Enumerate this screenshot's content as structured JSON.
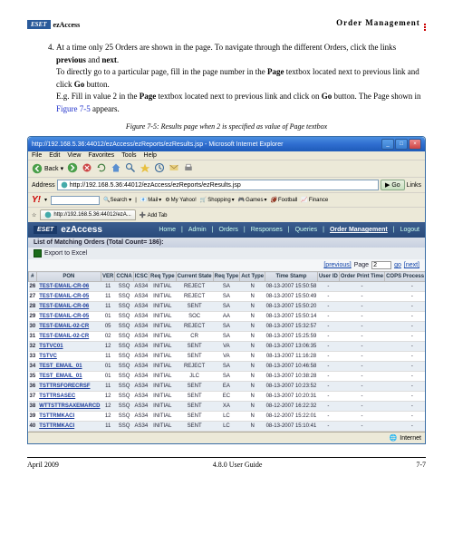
{
  "header": {
    "brand_badge": "ESET",
    "brand_text": "ezAccess",
    "title": "Order Management"
  },
  "instructions": {
    "item4_line1": "At a time only 25 Orders are shown in the page. To navigate through the different Orders, click the links ",
    "bold_prev": "previous",
    "and": " and ",
    "bold_next": "next",
    "period": ".",
    "line2a": "To directly go to a particular page, fill in the page number in the ",
    "bold_page": "Page",
    "line2b": " textbox located next to previous link and click ",
    "bold_go": "Go",
    "line2c": " button.",
    "line3a": "E.g. Fill in value 2 in the ",
    "line3b": " textbox located next to previous link and click on ",
    "line3c": " button. The Page shown in ",
    "figref": "Figure 7-5",
    "line3d": " appears."
  },
  "caption": "Figure 7-5:  Results page when 2 is specified as value of Page textbox",
  "browser": {
    "title_url": "http://192.168.5.36:44012/ezAccess/ezReports/ezResults.jsp - Microsoft Internet Explorer",
    "menus": [
      "File",
      "Edit",
      "View",
      "Favorites",
      "Tools",
      "Help"
    ],
    "back": "Back",
    "address_label": "Address",
    "address_value": "http://192.168.5.36:44012/ezAccess/ezReports/ezResults.jsp",
    "go_label": "Go",
    "links_label": "Links",
    "yahoo": {
      "search_btn": "Search",
      "links": [
        "Mail",
        "My Yahoo!",
        "Shopping",
        "Games",
        "Football",
        "Finance"
      ]
    },
    "tab_label": "http://192.168.5.36:44012/ezA...",
    "add_tab": "Add Tab",
    "status_text": "Internet"
  },
  "app": {
    "brand_badge": "ESET",
    "brand_text": "ezAccess",
    "nav": [
      "Home",
      "Admin",
      "Orders",
      "Responses",
      "Queries",
      "Order Management",
      "Logout"
    ],
    "list_title": "List of Matching Orders (Total Count= 186):",
    "export_label": "Export to Excel",
    "pager": {
      "previous": "[previous]",
      "page_label": "Page",
      "page_value": "2",
      "go": "go",
      "next": "[next]"
    },
    "columns": [
      "#",
      "PON",
      "VER",
      "CCNA",
      "ICSC",
      "Req Type",
      "Current State",
      "Req Type",
      "Act Type",
      "Time Stamp",
      "User ID",
      "Order Print Time",
      "COPS Process Time"
    ],
    "rows": [
      {
        "n": "26",
        "pon": "TEST-EMAIL-CR-06",
        "ver": "11",
        "ccna": "SSQ",
        "icsc": "AS34",
        "rt": "INITIAL",
        "cs": "REJECT",
        "rt2": "SA",
        "at": "N",
        "ts": "08-13-2007 15:50:58",
        "uid": "-",
        "opt": "-",
        "cpt": "-"
      },
      {
        "n": "27",
        "pon": "TEST-EMAIL-CR-05",
        "ver": "11",
        "ccna": "SSQ",
        "icsc": "AS34",
        "rt": "INITIAL",
        "cs": "REJECT",
        "rt2": "SA",
        "at": "N",
        "ts": "08-13-2007 15:50:49",
        "uid": "-",
        "opt": "-",
        "cpt": "-"
      },
      {
        "n": "28",
        "pon": "TEST-EMAIL-CR-06",
        "ver": "11",
        "ccna": "SSQ",
        "icsc": "AS34",
        "rt": "INITIAL",
        "cs": "SENT",
        "rt2": "SA",
        "at": "N",
        "ts": "08-13-2007 15:50:20",
        "uid": "-",
        "opt": "-",
        "cpt": "-"
      },
      {
        "n": "29",
        "pon": "TEST-EMAIL-CR-05",
        "ver": "01",
        "ccna": "SSQ",
        "icsc": "AS34",
        "rt": "INITIAL",
        "cs": "SOC",
        "rt2": "AA",
        "at": "N",
        "ts": "08-13-2007 15:50:14",
        "uid": "-",
        "opt": "-",
        "cpt": "-"
      },
      {
        "n": "30",
        "pon": "TEST-EMAIL-02-CR",
        "ver": "05",
        "ccna": "SSQ",
        "icsc": "AS34",
        "rt": "INITIAL",
        "cs": "REJECT",
        "rt2": "SA",
        "at": "N",
        "ts": "08-13-2007 15:32:57",
        "uid": "-",
        "opt": "-",
        "cpt": "-"
      },
      {
        "n": "31",
        "pon": "TEST-EMAIL-02-CR",
        "ver": "02",
        "ccna": "SSQ",
        "icsc": "AS34",
        "rt": "INITIAL",
        "cs": "CR",
        "rt2": "SA",
        "at": "N",
        "ts": "08-13-2007 15:25:59",
        "uid": "-",
        "opt": "-",
        "cpt": "-"
      },
      {
        "n": "32",
        "pon": "TSTVC01",
        "ver": "12",
        "ccna": "SSQ",
        "icsc": "AS34",
        "rt": "INITIAL",
        "cs": "SENT",
        "rt2": "VA",
        "at": "N",
        "ts": "08-13-2007 13:06:35",
        "uid": "-",
        "opt": "-",
        "cpt": "-"
      },
      {
        "n": "33",
        "pon": "TSTVC",
        "ver": "11",
        "ccna": "SSQ",
        "icsc": "AS34",
        "rt": "INITIAL",
        "cs": "SENT",
        "rt2": "VA",
        "at": "N",
        "ts": "08-13-2007 11:16:28",
        "uid": "-",
        "opt": "-",
        "cpt": "-"
      },
      {
        "n": "34",
        "pon": "TEST_EMAIL_01",
        "ver": "01",
        "ccna": "SSQ",
        "icsc": "AS34",
        "rt": "INITIAL",
        "cs": "REJECT",
        "rt2": "SA",
        "at": "N",
        "ts": "08-13-2007 10:46:58",
        "uid": "-",
        "opt": "-",
        "cpt": "-"
      },
      {
        "n": "35",
        "pon": "TEST_EMAIL_01",
        "ver": "01",
        "ccna": "SSQ",
        "icsc": "AS34",
        "rt": "INITIAL",
        "cs": "JLC",
        "rt2": "SA",
        "at": "N",
        "ts": "08-13-2007 10:38:28",
        "uid": "-",
        "opt": "-",
        "cpt": "-"
      },
      {
        "n": "36",
        "pon": "TSTTRSFORECRSF",
        "ver": "11",
        "ccna": "SSQ",
        "icsc": "AS34",
        "rt": "INITIAL",
        "cs": "SENT",
        "rt2": "EA",
        "at": "N",
        "ts": "08-13-2007 10:23:52",
        "uid": "-",
        "opt": "-",
        "cpt": "-"
      },
      {
        "n": "37",
        "pon": "TSTTRSASEC",
        "ver": "12",
        "ccna": "SSQ",
        "icsc": "AS34",
        "rt": "INITIAL",
        "cs": "SENT",
        "rt2": "EC",
        "at": "N",
        "ts": "08-13-2007 10:20:31",
        "uid": "-",
        "opt": "-",
        "cpt": "-"
      },
      {
        "n": "38",
        "pon": "WTTSTTRSAXEMARCD",
        "ver": "12",
        "ccna": "SSQ",
        "icsc": "AS34",
        "rt": "INITIAL",
        "cs": "SENT",
        "rt2": "XA",
        "at": "N",
        "ts": "08-12-2007 16:22:32",
        "uid": "-",
        "opt": "-",
        "cpt": "-"
      },
      {
        "n": "39",
        "pon": "TSTTRMKACI",
        "ver": "12",
        "ccna": "SSQ",
        "icsc": "AS34",
        "rt": "INITIAL",
        "cs": "SENT",
        "rt2": "LC",
        "at": "N",
        "ts": "08-12-2007 15:22:01",
        "uid": "-",
        "opt": "-",
        "cpt": "-"
      },
      {
        "n": "40",
        "pon": "TSTTRMKACI",
        "ver": "11",
        "ccna": "SSQ",
        "icsc": "AS34",
        "rt": "INITIAL",
        "cs": "SENT",
        "rt2": "LC",
        "at": "N",
        "ts": "08-13-2007 15:10:41",
        "uid": "-",
        "opt": "-",
        "cpt": "-"
      }
    ]
  },
  "footer": {
    "left": "April 2009",
    "center": "4.8.0 User Guide",
    "right": "7-7"
  }
}
